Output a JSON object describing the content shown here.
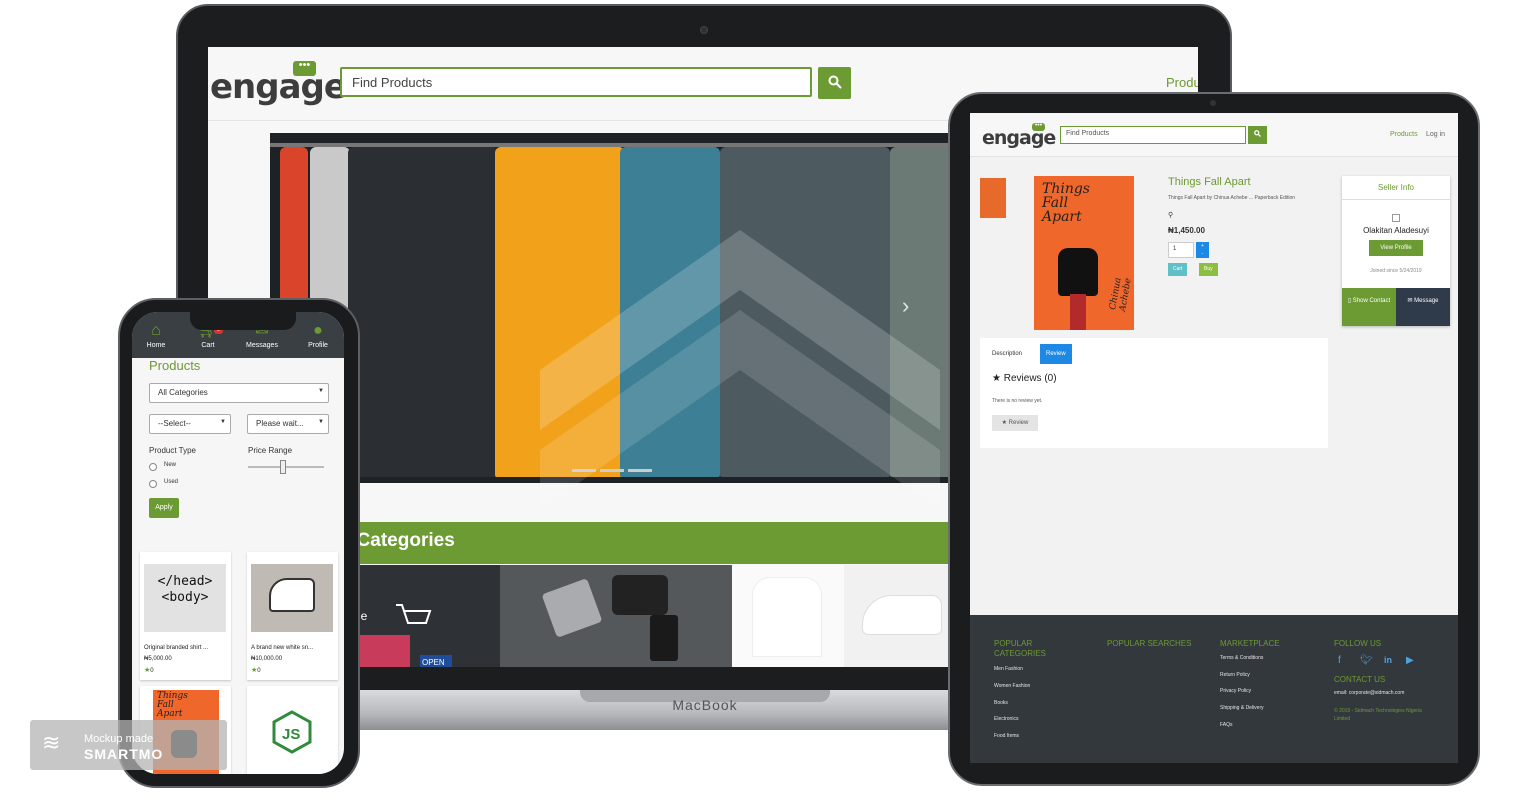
{
  "brand": {
    "logo_text": "engage",
    "accent": "#6c9a33"
  },
  "laptop": {
    "search_placeholder": "Find Products",
    "search_icon": "search-icon",
    "nav_products": "Produc",
    "hero_arrow": "›",
    "categories_title": "l Categories",
    "device_label": "MacBook"
  },
  "tablet": {
    "search_placeholder": "Find Products",
    "nav": {
      "products": "Products",
      "login": "Log in"
    },
    "product": {
      "title": "Things Fall Apart",
      "subtitle": "Things Fall Apart by Chinua Achebe ... Paperback Edition",
      "price": "₦1,450.00",
      "quantity": "1",
      "cart_label": "Cart",
      "buy_label": "Buy",
      "book_cover_title": "Things Fall Apart",
      "book_cover_author": "Chinua Achebe"
    },
    "seller": {
      "heading": "Seller Info",
      "name": "Olakitan Aladesuyi",
      "view_profile": "View Profile",
      "joined": "Joined since 5/24/2019",
      "show_contact": "Show Contact",
      "message": "Message"
    },
    "tabs": {
      "description": "Description",
      "review": "Review"
    },
    "reviews": {
      "heading": "Reviews (0)",
      "empty": "There is no review yet.",
      "button": "Review"
    },
    "footer": {
      "popular_categories": "POPULAR CATEGORIES",
      "categories": [
        "Men Fashion",
        "Women Fashion",
        "Books",
        "Electronics",
        "Food Items"
      ],
      "popular_searches": "POPULAR SEARCHES",
      "marketplace": "MARKETPLACE",
      "marketplace_links": [
        "Terms & Conditions",
        "Return Policy",
        "Privacy Policy",
        "Shipping & Delivery",
        "FAQs"
      ],
      "follow_us": "FOLLOW US",
      "contact_us": "CONTACT US",
      "email": "email: corporate@sidmach.com",
      "copyright": "© 2019 - Sidmach Technologies Nigeria Limited"
    }
  },
  "phone": {
    "nav": [
      "Home",
      "Cart",
      "Messages",
      "Profile"
    ],
    "cart_badge": "0",
    "title": "Products",
    "category_select": "All Categories",
    "select_1": "--Select--",
    "select_2": "Please wait...",
    "product_type_label": "Product Type",
    "types": [
      "New",
      "Used"
    ],
    "price_range_label": "Price Range",
    "apply": "Apply",
    "cards": [
      {
        "name": "Original branded shirt ...",
        "price": "₦5,000.00",
        "rating": "0",
        "image_text": "</head>\n<body>"
      },
      {
        "name": "A brand new white sn...",
        "price": "₦10,000.00",
        "rating": "0"
      }
    ]
  },
  "watermark": {
    "line1": "Mockup made",
    "line2": "SMARTMO"
  }
}
